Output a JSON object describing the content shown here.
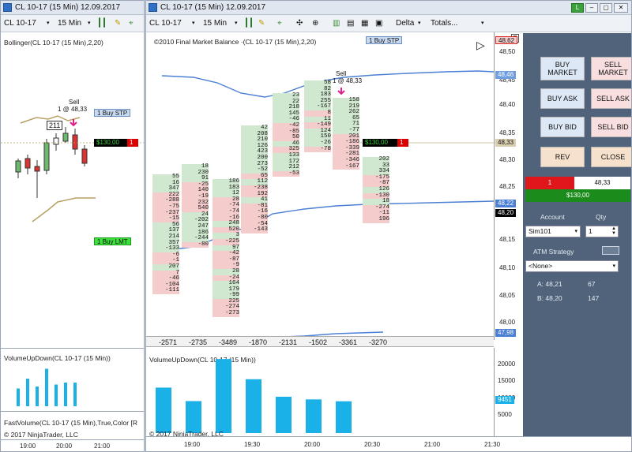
{
  "left_chart": {
    "title": "CL 10-17 (15 Min)  12.09.2017",
    "instrument": "CL 10-17",
    "period": "15 Min",
    "indicator_label": "Bollinger(CL 10-17 (15 Min),2,20)",
    "sell_label": "Sell",
    "sell_detail": "1 @ 48,33",
    "price_tag": "211",
    "buy_stp_qty": "1",
    "buy_stp_label": "Buy STP",
    "buy_lmt_qty": "1",
    "buy_lmt_label": "Buy LMT",
    "pnl": "$130,00",
    "pnl_qty": "1",
    "volume_label": "VolumeUpDown(CL 10-17 (15 Min))",
    "fastvolume_label": "FastVolume(CL 10-17 (15 Min),True,Color [R",
    "copyright": "© 2017 NinjaTrader, LLC",
    "time_ticks": [
      "19:00",
      "20:00",
      "21:00"
    ],
    "volume_bars": [
      0.45,
      0.7,
      0.5,
      0.95,
      0.55,
      0.6,
      0.6
    ]
  },
  "main_chart": {
    "title": "CL 10-17 (15 Min)  12.09.2017",
    "instrument": "CL 10-17",
    "period": "15 Min",
    "delta_label": "Delta",
    "totals_label": "Totals...",
    "indicator_label": "©2010 Final Market Balance  ·(CL 10-17 (15 Min),2,20)",
    "sell_label": "Sell",
    "sell_detail": "1 @ 48,33",
    "buy_stp_qty": "1",
    "buy_stp_label": "Buy STP",
    "pnl": "$130,00",
    "pnl_qty": "1",
    "price_axis": [
      "48,50",
      "48,45",
      "48,40",
      "48,35",
      "48,30",
      "48,25",
      "48,15",
      "48,10",
      "48,05",
      "48,00"
    ],
    "price_marks": {
      "top": "48,62",
      "upper_band": "48,46",
      "last": "48,33",
      "ask": "48,22",
      "bid": "48,20",
      "lower_band": "47,98"
    },
    "totals": [
      "-2571",
      "-2735",
      "-3489",
      "-1870",
      "-2131",
      "-1502",
      "-3361",
      "-3270"
    ],
    "volume_label": "VolumeUpDown(CL 10-17 (15 Min))",
    "volume_axis": [
      "20000",
      "15000",
      "10000",
      "5000"
    ],
    "volume_last": "9451",
    "volume_bars": [
      13500,
      9500,
      22000,
      16000,
      10800,
      10000,
      9451
    ],
    "copyright": "© 2017 NinjaTrader, LLC",
    "time_ticks": [
      "19:00",
      "19:30",
      "20:00",
      "20:30",
      "21:00",
      "21:30"
    ],
    "ladders": [
      {
        "prices": [
          "55",
          "16",
          "347",
          "222",
          "-288",
          "-75",
          "-237",
          "-15",
          "56",
          "137",
          "214",
          "357",
          "-133",
          "-6",
          "-1",
          "207",
          "7",
          "-46",
          "-104",
          "-111"
        ],
        "colors": "gggrrrrrgggggrrgrrrr"
      },
      {
        "prices": [
          "18",
          "230",
          "91",
          "-25",
          "140",
          "-19",
          "232",
          "540",
          "24",
          "-202",
          "247",
          "186",
          "-244",
          "-80"
        ],
        "colors": "gggrrrrrgggggr"
      },
      {
        "prices": [
          "186",
          "183",
          "12",
          "28",
          "-74",
          "-74",
          "-16",
          "248",
          "520",
          "3",
          "-225",
          "97",
          "-42",
          "-87",
          "-9",
          "28",
          "-24",
          "164",
          "179",
          "-99",
          "225",
          "-274",
          "-273"
        ],
        "colors": "gggrrrrgrgrgrrrgrgggrrr"
      },
      {
        "prices": [
          "42",
          "208",
          "210",
          "126",
          "423",
          "200",
          "273",
          "-52",
          "65",
          "112",
          "-238",
          "192",
          "41",
          "-81",
          "-16",
          "-80",
          "-54",
          "-143"
        ],
        "colors": "ggggggggrgrrgrrrrr"
      },
      {
        "prices": [
          "23",
          "22",
          "218",
          "145",
          "-46",
          "-42",
          "-85",
          "50",
          "46",
          "325",
          "133",
          "172",
          "212",
          "-53"
        ],
        "colors": "gggggrrrgrgggr"
      },
      {
        "prices": [
          "58",
          "82",
          "183",
          "255",
          "-167",
          "8",
          "11",
          "-149",
          "124",
          "150",
          "-26",
          "-78"
        ],
        "colors": "gggggrgrgggr"
      },
      {
        "prices": [
          "158",
          "219",
          "262",
          "65",
          "71",
          "-77",
          "201",
          "-186",
          "-339",
          "-281",
          "-346",
          "-167"
        ],
        "colors": "ggggggrrrrrr"
      },
      {
        "prices": [
          "202",
          "33",
          "334",
          "-175",
          "-87",
          "126",
          "-130",
          "18",
          "-274",
          "-11",
          "196"
        ],
        "colors": "gggrrgrgrrr"
      }
    ]
  },
  "order_panel": {
    "buy_market": "BUY MARKET",
    "sell_market": "SELL MARKET",
    "buy_ask": "BUY ASK",
    "sell_ask": "SELL ASK",
    "buy_bid": "BUY BID",
    "sell_bid": "SELL BID",
    "rev": "REV",
    "close": "CLOSE",
    "position_qty": "1",
    "position_price": "48,33",
    "position_pnl": "$130,00",
    "account_label": "Account",
    "qty_label": "Qty",
    "account_value": "Sim101",
    "qty_value": "1",
    "atm_label": "ATM Strategy",
    "atm_value": "<None>",
    "ask_label": "A: 48,21",
    "ask_size": "67",
    "bid_label": "B: 48,20",
    "bid_size": "147"
  }
}
